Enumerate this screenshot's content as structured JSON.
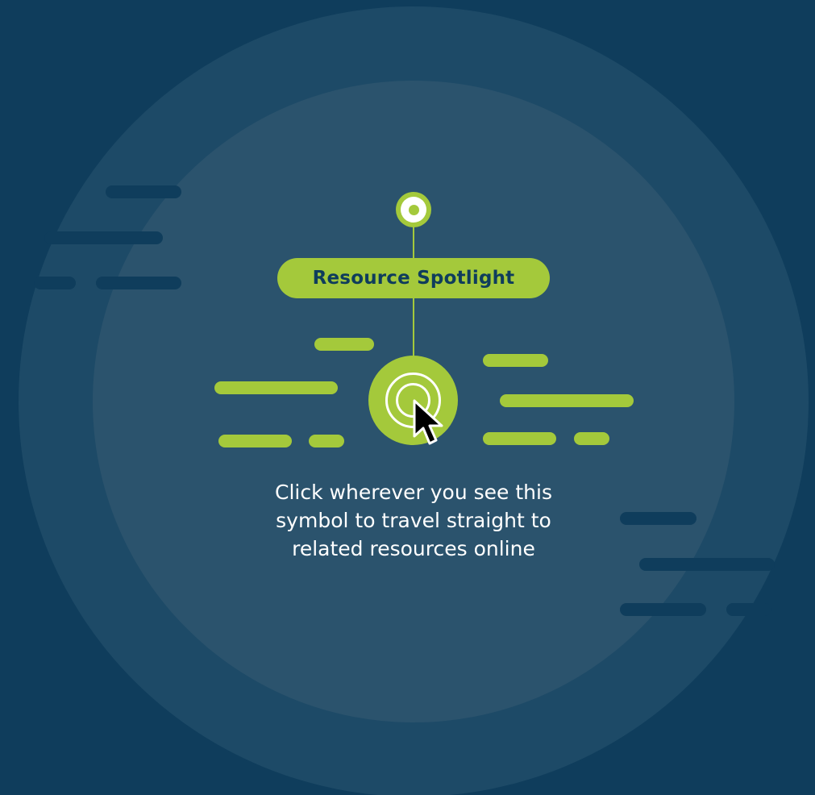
{
  "badge": {
    "label": "Resource Spotlight"
  },
  "caption": {
    "line1": "Click wherever you see this",
    "line2": "symbol to travel straight to",
    "line3": "related resources online"
  },
  "icons": {
    "pin": "pin-dot-icon",
    "target": "target-icon",
    "cursor": "mouse-pointer-icon"
  },
  "colors": {
    "background": "#0f3d5c",
    "outer_circle": "#1d4a67",
    "inner_circle": "#2b536d",
    "accent": "#a4c93b",
    "text": "#ffffff",
    "badge_text": "#0f3d5c"
  }
}
